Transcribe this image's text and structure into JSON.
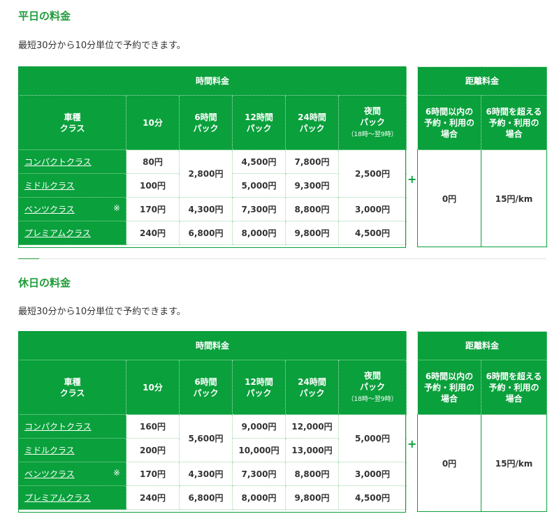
{
  "sections": [
    {
      "title": "平日の料金",
      "note": "最短30分から10分単位で予約できます。",
      "time_header": "時間料金",
      "columns": {
        "class": "車種\nクラス",
        "c10": "10分",
        "c6h": "6時間\nパック",
        "c12h": "12時間\nパック",
        "c24h": "24時間\nパック",
        "night": "夜間\nパック",
        "night_sub": "（18時～翌9時）"
      },
      "rows": [
        {
          "class": "コンパクトクラス",
          "mark": "",
          "m10": "80円",
          "h6": "2,800円",
          "h12": "4,500円",
          "h24": "7,800円",
          "night": "2,500円"
        },
        {
          "class": "ミドルクラス",
          "mark": "",
          "m10": "100円",
          "h12": "5,000円",
          "h24": "9,300円"
        },
        {
          "class": "ベンツクラス",
          "mark": "※",
          "m10": "170円",
          "h6": "4,300円",
          "h12": "7,300円",
          "h24": "8,800円",
          "night": "3,000円"
        },
        {
          "class": "プレミアムクラス",
          "mark": "",
          "m10": "240円",
          "h6": "6,800円",
          "h12": "8,000円",
          "h24": "9,800円",
          "night": "4,500円"
        }
      ],
      "plus": "+",
      "distance": {
        "header": "距離料金",
        "col1": "6時間以内の\n予約・利用の\n場合",
        "col2": "6時間を超える\n予約・利用の\n場合",
        "val1": "0円",
        "val2": "15円/km"
      }
    },
    {
      "title": "休日の料金",
      "note": "最短30分から10分単位で予約できます。",
      "time_header": "時間料金",
      "columns": {
        "class": "車種\nクラス",
        "c10": "10分",
        "c6h": "6時間\nパック",
        "c12h": "12時間\nパック",
        "c24h": "24時間\nパック",
        "night": "夜間\nパック",
        "night_sub": "（18時～翌9時）"
      },
      "rows": [
        {
          "class": "コンパクトクラス",
          "mark": "",
          "m10": "160円",
          "h6": "5,600円",
          "h12": "9,000円",
          "h24": "12,000円",
          "night": "5,000円"
        },
        {
          "class": "ミドルクラス",
          "mark": "",
          "m10": "200円",
          "h12": "10,000円",
          "h24": "13,000円"
        },
        {
          "class": "ベンツクラス",
          "mark": "※",
          "m10": "170円",
          "h6": "4,300円",
          "h12": "7,300円",
          "h24": "8,800円",
          "night": "3,000円"
        },
        {
          "class": "プレミアムクラス",
          "mark": "",
          "m10": "240円",
          "h6": "6,800円",
          "h12": "8,000円",
          "h24": "9,800円",
          "night": "4,500円"
        }
      ],
      "plus": "+",
      "distance": {
        "header": "距離料金",
        "col1": "6時間以内の\n予約・利用の\n場合",
        "col2": "6時間を超える\n予約・利用の\n場合",
        "val1": "0円",
        "val2": "15円/km"
      }
    }
  ],
  "colors": {
    "brand_green": "#0aa03c",
    "title_green": "#1f9c3a"
  }
}
